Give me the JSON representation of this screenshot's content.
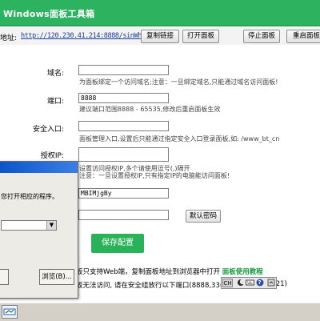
{
  "window": {
    "title": "Windows面板工具箱"
  },
  "address": {
    "label": "地址:",
    "url": "http://120.230.41.214:8888/sinWhvWB",
    "copy_btn": "复制链接",
    "open_btn": "打开面板",
    "stop_btn": "停止面板",
    "restart_btn": "重启面板"
  },
  "form": {
    "domain_label": "域名:",
    "domain_value": "",
    "domain_hint": "为面板绑定一个访问域名;注意：一旦绑定域名,只能通过域名访问面板!",
    "port_label": "端口:",
    "port_value": "8888",
    "port_hint": "建议端口范围8888 - 65535,修改后重启面板生效",
    "entry_label": "安全入口:",
    "entry_value": "",
    "entry_hint": "面板管理入口,设置后只能通过指定安全入口登录面板,如: /www_bt_cn",
    "authip_label": "授权IP:",
    "authip_value": "",
    "authip_hint1": "设置访问授权IP,多个请使用逗号(,)隔开",
    "authip_hint2": "注意：一旦设置授权IP,只有指定IP的电脑能访问面板!",
    "username_value": "MBIMjgBy",
    "password_value": "",
    "default_pwd_btn": "默认密码",
    "save_btn": "保存配置"
  },
  "notes": {
    "line1_text": "板只支持Web端，复制面板地址到浏览器中打开",
    "line1_link": "面板使用教程",
    "line2_text": "板无法访问, 请在安全组放行以下端口(8888,33(",
    "line2_tail": ",21)"
  },
  "dialog": {
    "message": "您打开相应的程序。",
    "dropdown_arrow": "▼",
    "browse_btn": "浏览(B)..."
  },
  "ime": {
    "mode": "CH",
    "help": "?"
  }
}
